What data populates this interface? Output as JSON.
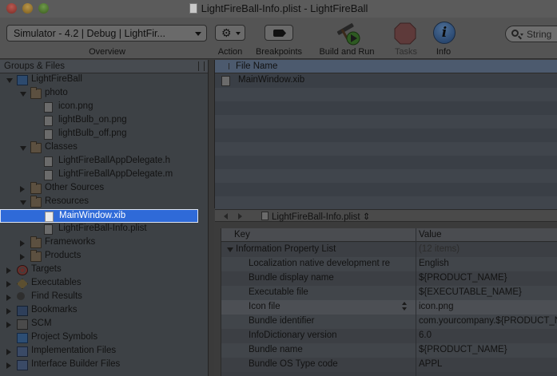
{
  "window": {
    "title": "LightFireBall-Info.plist - LightFireBall"
  },
  "toolbar": {
    "overview_value": "Simulator - 4.2 | Debug | LightFir...",
    "overview_label": "Overview",
    "action_label": "Action",
    "breakpoints_label": "Breakpoints",
    "build_label": "Build and Run",
    "tasks_label": "Tasks",
    "info_label": "Info",
    "info_glyph": "i",
    "search_placeholder": "String"
  },
  "sidebar": {
    "header": "Groups & Files",
    "items": [
      {
        "label": "LightFireBall",
        "icon": "project-icon",
        "disclosure": "open"
      },
      {
        "label": "photo",
        "icon": "folder-icon",
        "disclosure": "open"
      },
      {
        "label": "icon.png",
        "icon": "file-icon"
      },
      {
        "label": "lightBulb_on.png",
        "icon": "file-icon"
      },
      {
        "label": "lightBulb_off.png",
        "icon": "file-icon"
      },
      {
        "label": "Classes",
        "icon": "folder-icon",
        "disclosure": "open"
      },
      {
        "label": "LightFireBallAppDelegate.h",
        "icon": "file-icon"
      },
      {
        "label": "LightFireBallAppDelegate.m",
        "icon": "file-icon"
      },
      {
        "label": "Other Sources",
        "icon": "folder-icon",
        "disclosure": "closed"
      },
      {
        "label": "Resources",
        "icon": "folder-icon",
        "disclosure": "open"
      },
      {
        "label": "MainWindow.xib",
        "icon": "file-icon",
        "selected": true
      },
      {
        "label": "LightFireBall-Info.plist",
        "icon": "file-icon"
      },
      {
        "label": "Frameworks",
        "icon": "folder-icon",
        "disclosure": "closed"
      },
      {
        "label": "Products",
        "icon": "folder-icon",
        "disclosure": "closed"
      },
      {
        "label": "Targets",
        "icon": "target-icon",
        "disclosure": "closed"
      },
      {
        "label": "Executables",
        "icon": "executable-icon",
        "disclosure": "closed"
      },
      {
        "label": "Find Results",
        "icon": "find-icon",
        "disclosure": "closed"
      },
      {
        "label": "Bookmarks",
        "icon": "bookmark-icon",
        "disclosure": "closed"
      },
      {
        "label": "SCM",
        "icon": "scm-icon",
        "disclosure": "closed"
      },
      {
        "label": "Project Symbols",
        "icon": "cube-icon"
      },
      {
        "label": "Implementation Files",
        "icon": "smart-group-icon",
        "disclosure": "closed"
      },
      {
        "label": "Interface Builder Files",
        "icon": "smart-group-icon",
        "disclosure": "closed"
      }
    ]
  },
  "file_list": {
    "header": "File Name",
    "rows": [
      "MainWindow.xib"
    ]
  },
  "nav_bar": {
    "file": "LightFireBall-Info.plist ⇕"
  },
  "plist": {
    "columns": {
      "key": "Key",
      "value": "Value"
    },
    "root": {
      "key": "Information Property List",
      "value": "(12 items)"
    },
    "rows": [
      {
        "key": "Localization native development re",
        "value": "English"
      },
      {
        "key": "Bundle display name",
        "value": "${PRODUCT_NAME}"
      },
      {
        "key": "Executable file",
        "value": "${EXECUTABLE_NAME}"
      },
      {
        "key": "Icon file",
        "value": "icon.png",
        "highlighted": true
      },
      {
        "key": "Bundle identifier",
        "value": "com.yourcompany.${PRODUCT_N"
      },
      {
        "key": "InfoDictionary version",
        "value": "6.0"
      },
      {
        "key": "Bundle name",
        "value": "${PRODUCT_NAME}"
      },
      {
        "key": "Bundle OS Type code",
        "value": "APPL"
      }
    ]
  }
}
